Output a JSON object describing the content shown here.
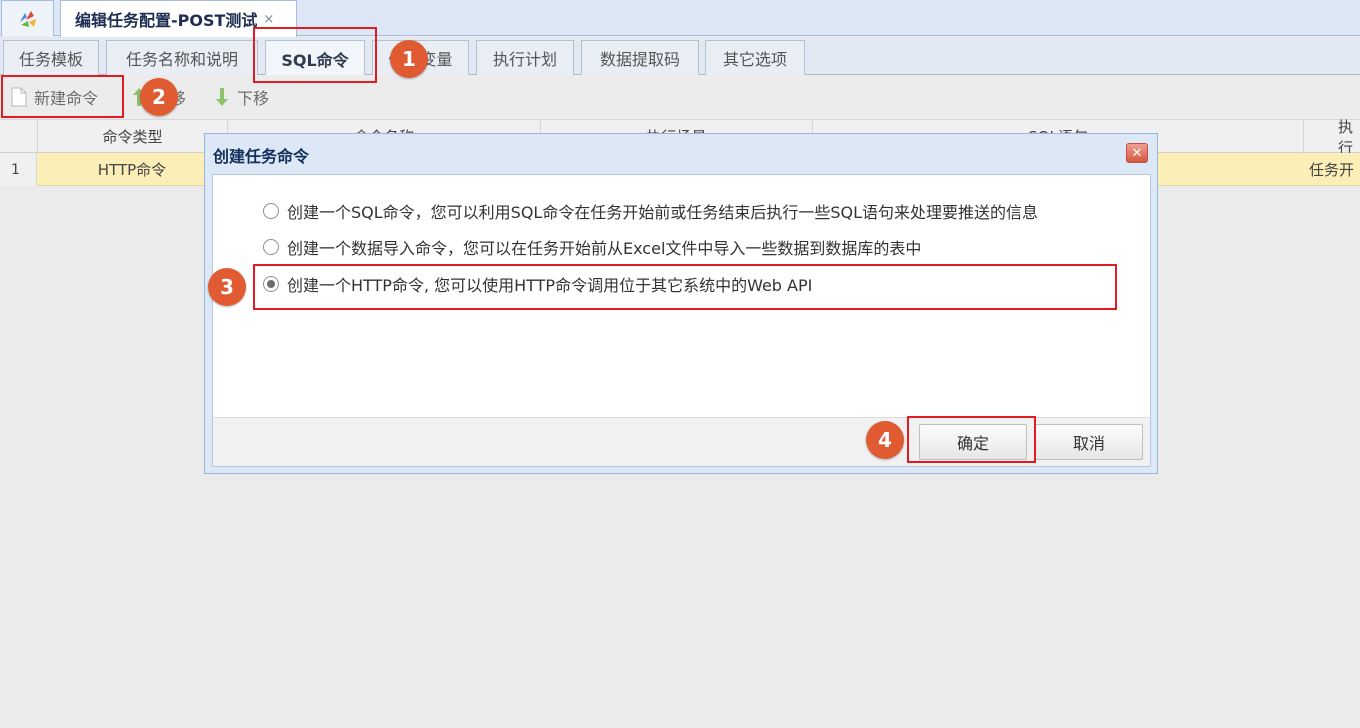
{
  "doc_tab": {
    "title": "编辑任务配置-POST测试",
    "close_glyph": "×",
    "home_icon": "app-logo-icon"
  },
  "section_tabs": [
    {
      "label": "任务模板"
    },
    {
      "label": "任务名称和说明"
    },
    {
      "label": "SQL命令"
    },
    {
      "label": "任务变量"
    },
    {
      "label": "执行计划"
    },
    {
      "label": "数据提取码"
    },
    {
      "label": "其它选项"
    }
  ],
  "toolbar": {
    "new_label": "新建命令",
    "up_label": "上移",
    "down_label": "下移"
  },
  "grid": {
    "columns": [
      "命令类型",
      "命令名称",
      "执行场景",
      "SQL语句",
      "执行"
    ],
    "rows": [
      {
        "num": "1",
        "type": "HTTP命令",
        "name": "",
        "scene": "",
        "sql": "",
        "exec": "任务开"
      }
    ]
  },
  "dialog": {
    "title": "创建任务命令",
    "options": [
      {
        "label": "创建一个SQL命令，您可以利用SQL命令在任务开始前或任务结束后执行一些SQL语句来处理要推送的信息",
        "checked": false
      },
      {
        "label": "创建一个数据导入命令，您可以在任务开始前从Excel文件中导入一些数据到数据库的表中",
        "checked": false
      },
      {
        "label": "创建一个HTTP命令, 您可以使用HTTP命令调用位于其它系统中的Web API",
        "checked": true
      }
    ],
    "ok_label": "确定",
    "cancel_label": "取消",
    "close_glyph": "✕"
  },
  "annotations": {
    "badges": [
      "1",
      "2",
      "3",
      "4"
    ],
    "badge_color": "#e05a32",
    "highlight_color": "#e31b23"
  },
  "colors": {
    "selected_row": "#fbeeb6",
    "dialog_border": "#99b6db"
  }
}
